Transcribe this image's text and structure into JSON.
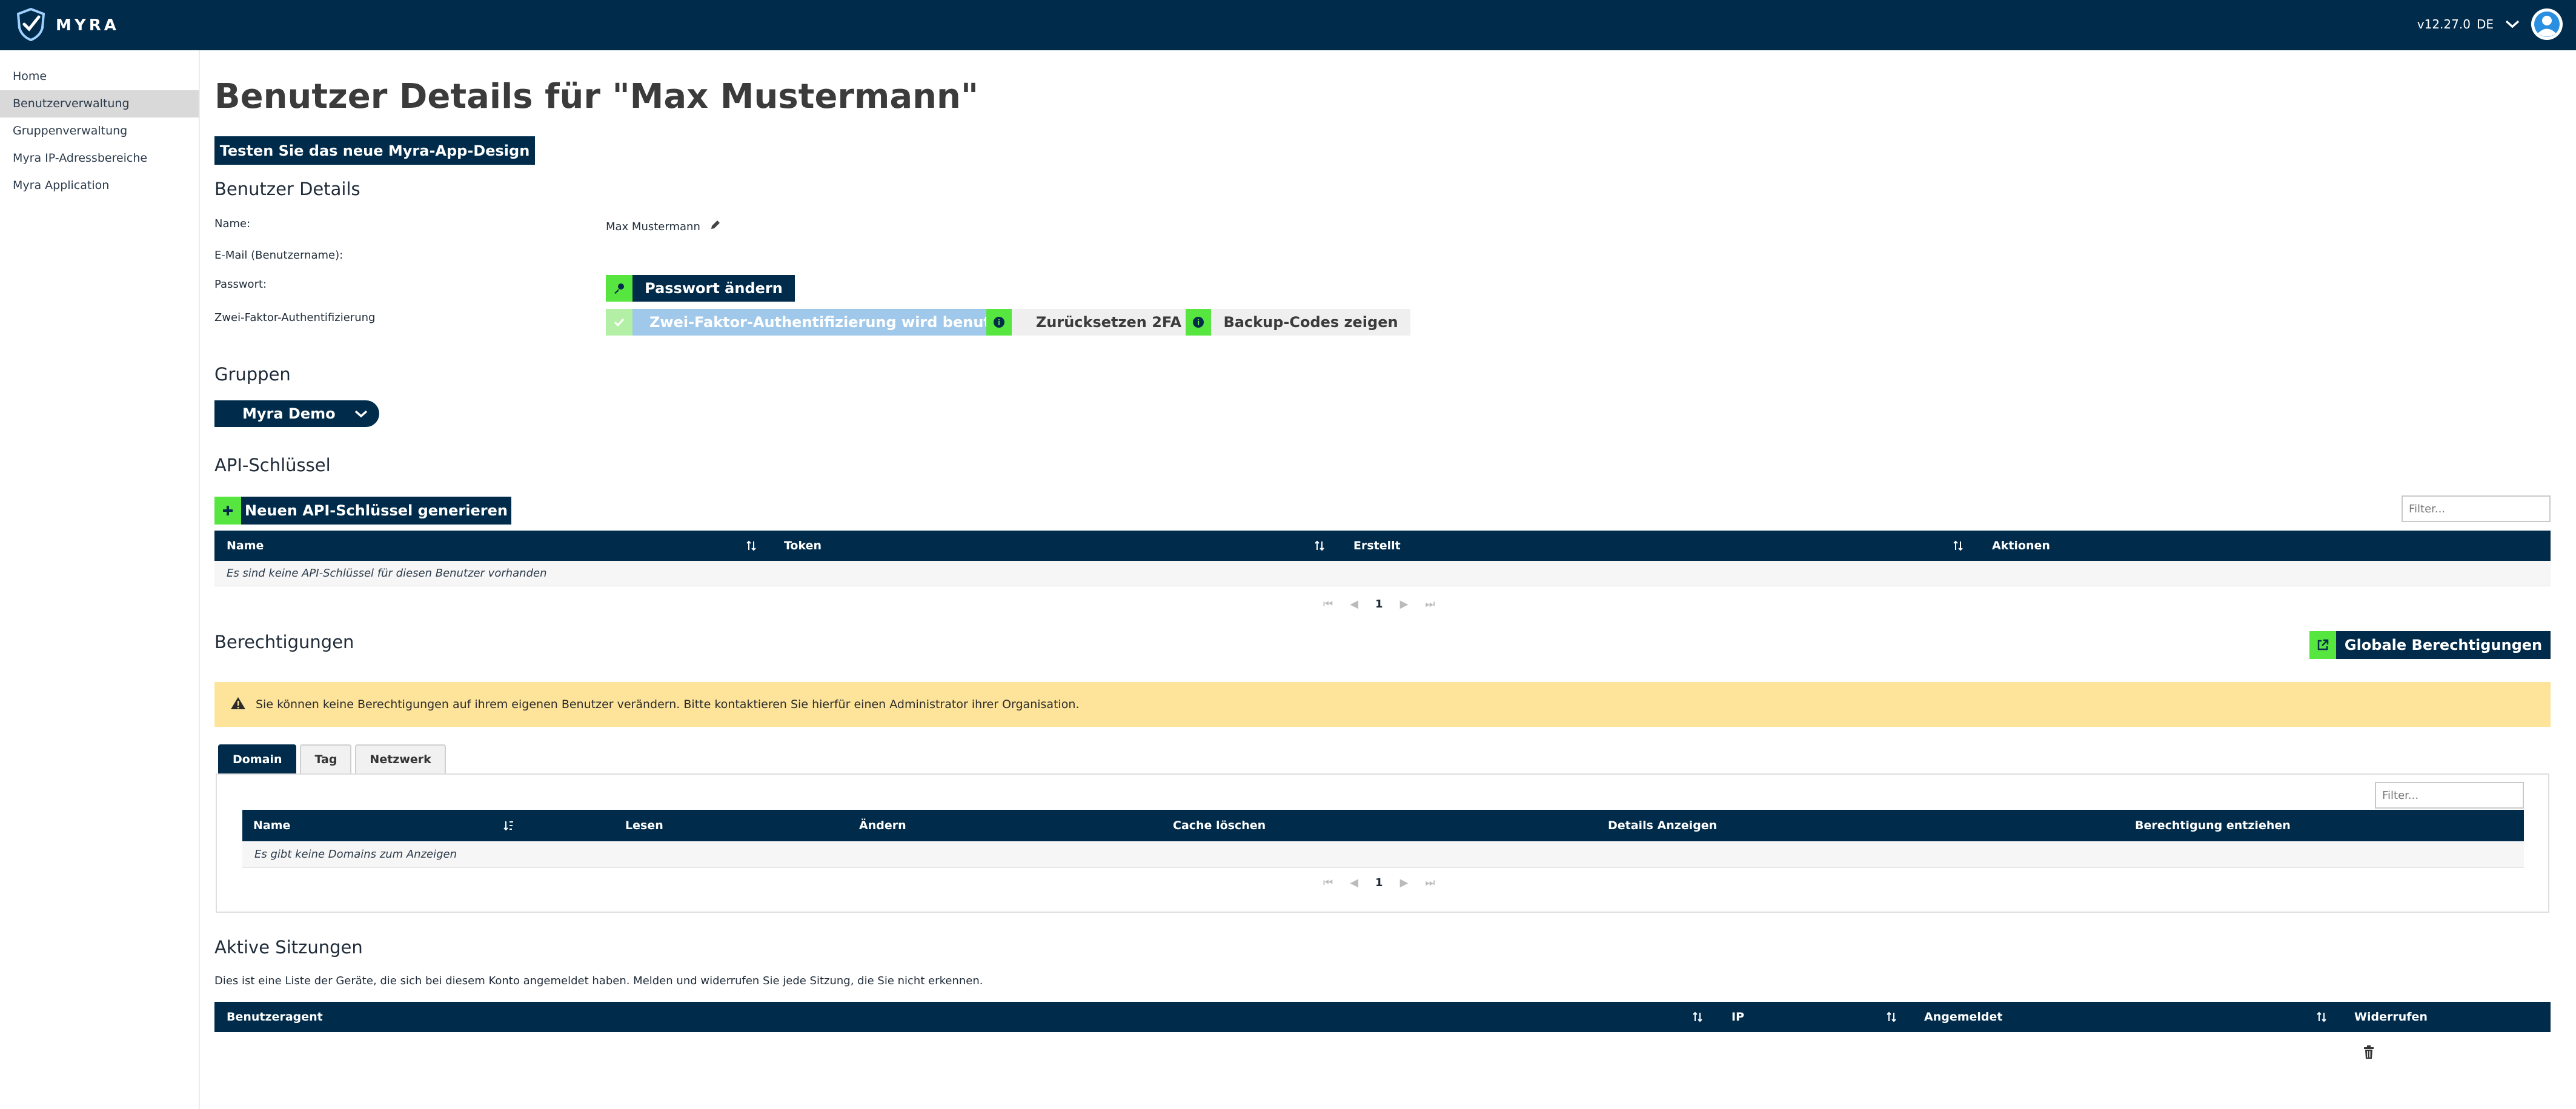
{
  "header": {
    "brand": "MYRA",
    "version": "v12.27.0",
    "language": "DE"
  },
  "sidebar": {
    "items": [
      {
        "label": "Home"
      },
      {
        "label": "Benutzerverwaltung"
      },
      {
        "label": "Gruppenverwaltung"
      },
      {
        "label": "Myra IP-Adressbereiche"
      },
      {
        "label": "Myra Application"
      }
    ]
  },
  "page": {
    "title": "Benutzer Details für \"Max Mustermann\"",
    "new_design_button": "Testen Sie das neue Myra-App-Design"
  },
  "user_details": {
    "heading": "Benutzer Details",
    "name_label": "Name:",
    "name_value": "Max Mustermann",
    "email_label": "E-Mail (Benutzername):",
    "password_label": "Passwort:",
    "password_button": "Passwort ändern",
    "twofa_label": "Zwei-Faktor-Authentifizierung",
    "twofa_status": "Zwei-Faktor-Authentifizierung wird benutzt",
    "reset_2fa_button": "Zurücksetzen 2FA",
    "backup_codes_button": "Backup-Codes zeigen"
  },
  "groups": {
    "heading": "Gruppen",
    "selected": "Myra Demo"
  },
  "api_keys": {
    "heading": "API-Schlüssel",
    "generate_button": "Neuen API-Schlüssel generieren",
    "filter_placeholder": "Filter...",
    "columns": [
      "Name",
      "Token",
      "Erstellt",
      "Aktionen"
    ],
    "empty_text": "Es sind keine API-Schlüssel für diesen Benutzer vorhanden",
    "page": "1"
  },
  "permissions": {
    "heading": "Berechtigungen",
    "global_button": "Globale Berechtigungen",
    "warning": "Sie können keine Berechtigungen auf ihrem eigenen Benutzer verändern. Bitte kontaktieren Sie hierfür einen Administrator ihrer Organisation.",
    "tabs": [
      "Domain",
      "Tag",
      "Netzwerk"
    ],
    "filter_placeholder": "Filter...",
    "columns": [
      "Name",
      "Lesen",
      "Ändern",
      "Cache löschen",
      "Details Anzeigen",
      "Berechtigung entziehen"
    ],
    "empty_text": "Es gibt keine Domains zum Anzeigen",
    "page": "1"
  },
  "sessions": {
    "heading": "Aktive Sitzungen",
    "description": "Dies ist eine Liste der Geräte, die sich bei diesem Konto angemeldet haben. Melden und widerrufen Sie jede Sitzung, die Sie nicht erkennen.",
    "columns": [
      "Benutzeragent",
      "IP",
      "Angemeldet",
      "Widerrufen"
    ]
  },
  "colors": {
    "navy": "#002b4a",
    "green": "#56e63f",
    "twofa_blue": "#9fc8ea",
    "warning_yellow": "#fde49a"
  }
}
